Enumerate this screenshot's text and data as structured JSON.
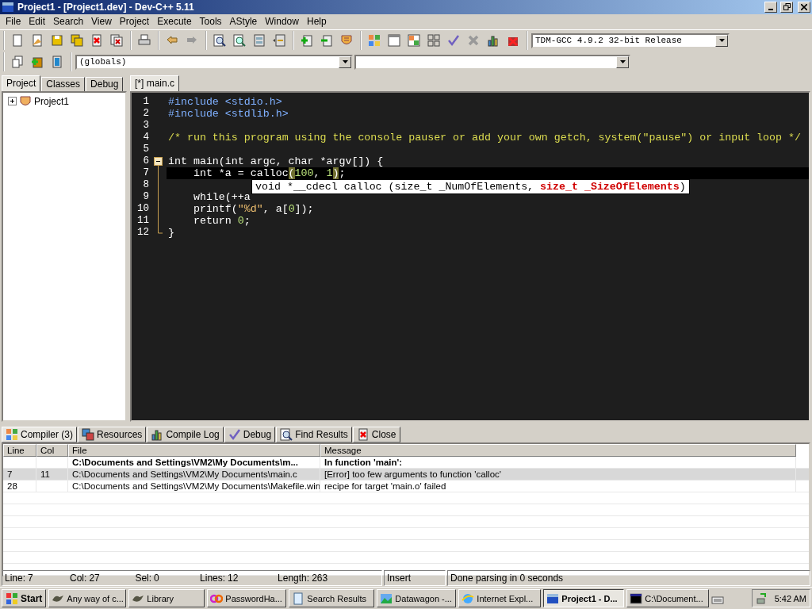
{
  "window": {
    "title": "Project1 - [Project1.dev] - Dev-C++ 5.11"
  },
  "menu": [
    "File",
    "Edit",
    "Search",
    "View",
    "Project",
    "Execute",
    "Tools",
    "AStyle",
    "Window",
    "Help"
  ],
  "toolbar": {
    "compiler_select": "TDM-GCC 4.9.2 32-bit Release",
    "scope_select": "(globals)"
  },
  "left_tabs": [
    {
      "label": "Project",
      "selected": true
    },
    {
      "label": "Classes",
      "selected": false
    },
    {
      "label": "Debug",
      "selected": false
    }
  ],
  "tree": [
    {
      "label": "Project1",
      "expanded": false
    }
  ],
  "editor_tabs": [
    {
      "label": "[*] main.c",
      "selected": true
    }
  ],
  "code": [
    {
      "number": "1",
      "kind": "plain",
      "current": false,
      "tokens": [
        {
          "kind": "preproc",
          "text": "#include <stdio.h>"
        }
      ]
    },
    {
      "number": "2",
      "kind": "plain",
      "current": false,
      "tokens": [
        {
          "kind": "preproc",
          "text": "#include <stdlib.h>"
        }
      ]
    },
    {
      "number": "3",
      "kind": "plain",
      "current": false
    },
    {
      "number": "4",
      "kind": "plain",
      "current": false,
      "tokens": [
        {
          "kind": "comment",
          "text": "/* run this program using the console pauser or add your own getch, system(\"pause\") or input loop */"
        }
      ]
    },
    {
      "number": "5",
      "kind": "plain",
      "current": false
    },
    {
      "number": "6",
      "kind": "foldstart",
      "current": false,
      "tokens": [
        {
          "kind": "plain",
          "text": "int main(int argc, char *argv[]) {"
        }
      ]
    },
    {
      "number": "7",
      "kind": "foldbody",
      "current": true,
      "tokens": [
        {
          "kind": "plain",
          "text": "    int *a = calloc"
        },
        {
          "kind": "match",
          "text": "("
        },
        {
          "kind": "number",
          "text": "100"
        },
        {
          "kind": "plain",
          "text": ", "
        },
        {
          "kind": "number",
          "text": "1"
        },
        {
          "kind": "match",
          "text": ")"
        },
        {
          "kind": "plain",
          "text": ";"
        }
      ]
    },
    {
      "number": "8",
      "kind": "foldbody",
      "current": false
    },
    {
      "number": "9",
      "kind": "foldbody",
      "current": false,
      "tokens": [
        {
          "kind": "plain",
          "text": "    while(++a"
        }
      ]
    },
    {
      "number": "10",
      "kind": "foldbody",
      "current": false,
      "tokens": [
        {
          "kind": "plain",
          "text": "    printf("
        },
        {
          "kind": "string",
          "text": "\"%d\""
        },
        {
          "kind": "plain",
          "text": ", a["
        },
        {
          "kind": "number",
          "text": "0"
        },
        {
          "kind": "plain",
          "text": "]);"
        }
      ]
    },
    {
      "number": "11",
      "kind": "foldbody",
      "current": false,
      "tokens": [
        {
          "kind": "plain",
          "text": "    return "
        },
        {
          "kind": "number",
          "text": "0"
        },
        {
          "kind": "plain",
          "text": ";"
        }
      ]
    },
    {
      "number": "12",
      "kind": "foldend",
      "current": false,
      "tokens": [
        {
          "kind": "plain",
          "text": "}"
        }
      ]
    }
  ],
  "tooltip": {
    "parts": [
      {
        "text": "void *__cdecl calloc (size_t _NumOfElements, ",
        "highlighted": false
      },
      {
        "text": "size_t _SizeOfElements",
        "highlighted": true
      },
      {
        "text": ")",
        "highlighted": false
      }
    ]
  },
  "bottom_tabs": [
    {
      "label": "Compiler (3)",
      "selected": true
    },
    {
      "label": "Resources",
      "selected": false
    },
    {
      "label": "Compile Log",
      "selected": false
    },
    {
      "label": "Debug",
      "selected": false
    },
    {
      "label": "Find Results",
      "selected": false
    },
    {
      "label": "Close",
      "selected": false
    }
  ],
  "table": {
    "columns": [
      "Line",
      "Col",
      "File",
      "Message"
    ],
    "rows": [
      {
        "kind": "context",
        "selected": false,
        "cells": [
          "",
          "",
          "C:\\Documents and Settings\\VM2\\My Documents\\m...",
          "In function 'main':"
        ]
      },
      {
        "kind": "message",
        "selected": true,
        "cells": [
          "7",
          "11",
          "C:\\Documents and Settings\\VM2\\My Documents\\main.c",
          "[Error] too few arguments to function 'calloc'"
        ]
      },
      {
        "kind": "message",
        "selected": false,
        "cells": [
          "28",
          "",
          "C:\\Documents and Settings\\VM2\\My Documents\\Makefile.win",
          "recipe for target 'main.o' failed"
        ]
      }
    ]
  },
  "status_bar": {
    "fields": [
      {
        "label": "Line:",
        "value": "7"
      },
      {
        "label": "Col:",
        "value": "27"
      },
      {
        "label": "Sel:",
        "value": "0"
      },
      {
        "label": "Lines:",
        "value": "12"
      },
      {
        "label": "Length:",
        "value": "263"
      }
    ],
    "mode": "Insert",
    "message": "Done parsing in 0 seconds"
  },
  "taskbar": {
    "start": "Start",
    "items": [
      {
        "label": "Any way of c...",
        "selected": false
      },
      {
        "label": "Library",
        "selected": false
      },
      {
        "label": "PasswordHa...",
        "selected": false
      },
      {
        "label": "Search Results",
        "selected": false
      },
      {
        "label": "Datawagon -...",
        "selected": false
      },
      {
        "label": "Internet Expl...",
        "selected": false
      },
      {
        "label": "Project1 - D...",
        "selected": true
      },
      {
        "label": "C:\\Document...",
        "selected": false
      }
    ],
    "clock": "5:42 AM"
  }
}
